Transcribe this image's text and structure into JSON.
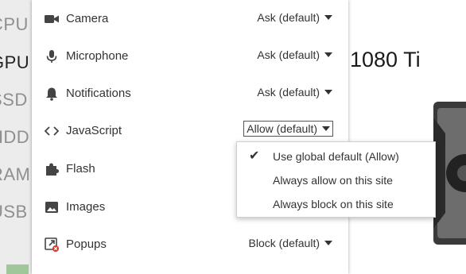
{
  "background": {
    "nav_items": [
      {
        "label": "CPU",
        "active": false
      },
      {
        "label": "GPU",
        "active": true
      },
      {
        "label": "SSD",
        "active": false
      },
      {
        "label": "HDD",
        "active": false
      },
      {
        "label": "RAM",
        "active": false
      },
      {
        "label": "USB",
        "active": false
      }
    ],
    "title": "1080 Ti"
  },
  "permissions": [
    {
      "name": "Camera",
      "icon": "camera-icon",
      "value": "Ask (default)"
    },
    {
      "name": "Microphone",
      "icon": "microphone-icon",
      "value": "Ask (default)"
    },
    {
      "name": "Notifications",
      "icon": "bell-icon",
      "value": "Ask (default)"
    },
    {
      "name": "JavaScript",
      "icon": "code-icon",
      "value": "Allow (default)"
    },
    {
      "name": "Flash",
      "icon": "puzzle-icon",
      "value": ""
    },
    {
      "name": "Images",
      "icon": "image-icon",
      "value": ""
    },
    {
      "name": "Popups",
      "icon": "popup-blocked-icon",
      "value": "Block (default)"
    }
  ],
  "dropdown": {
    "items": [
      {
        "label": "Use global default (Allow)",
        "checked": true
      },
      {
        "label": "Always allow on this site",
        "checked": false
      },
      {
        "label": "Always block on this site",
        "checked": false
      }
    ]
  }
}
